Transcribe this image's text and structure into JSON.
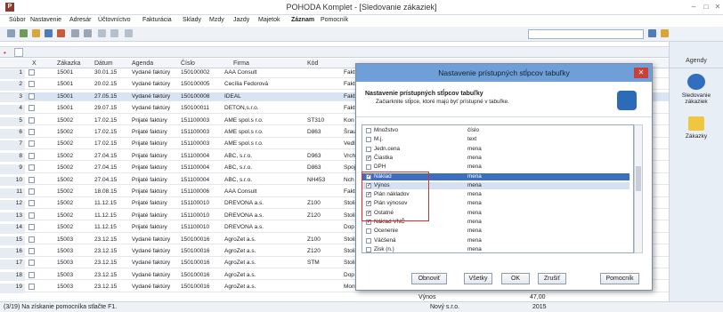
{
  "window": {
    "title": "POHODA Komplet - [Sledovanie zákaziek]",
    "app_icon": "P",
    "minimize": "–",
    "maximize": "□",
    "close": "✕"
  },
  "menu": [
    "Súbor",
    "Nastavenie",
    "Adresár",
    "Účtovníctvo",
    "Fakturácia",
    "Sklady",
    "Mzdy",
    "Jazdy",
    "Majetok",
    "Záznam",
    "Pomocník"
  ],
  "grid": {
    "columns": [
      "X",
      "Zákazka",
      "Dátum",
      "Agenda",
      "Číslo",
      "Firma",
      "Kód"
    ],
    "rows": [
      {
        "n": "1",
        "z": "15001",
        "d": "30.01.15",
        "a": "Vydané faktúry",
        "c": "150100002",
        "f": "AAA Consult",
        "k": "",
        "e": "Fakt"
      },
      {
        "n": "2",
        "z": "15001",
        "d": "20.02.15",
        "a": "Vydané faktúry",
        "c": "150100005",
        "f": "Cecília Fedorová",
        "k": "",
        "e": "Fakt"
      },
      {
        "n": "3",
        "z": "15001",
        "d": "27.05.15",
        "a": "Vydané faktúry",
        "c": "150100008",
        "f": "IDEAL",
        "k": "",
        "e": "Fakt"
      },
      {
        "n": "4",
        "z": "15001",
        "d": "29.07.15",
        "a": "Vydané faktúry",
        "c": "150100011",
        "f": "DETON,s.r.o.",
        "k": "",
        "e": "Fakt"
      },
      {
        "n": "5",
        "z": "15002",
        "d": "17.02.15",
        "a": "Prijaté faktúry",
        "c": "151100003",
        "f": "AME spol.s r.o.",
        "k": "ST310",
        "e": "Kon"
      },
      {
        "n": "6",
        "z": "15002",
        "d": "17.02.15",
        "a": "Prijaté faktúry",
        "c": "151100003",
        "f": "AME spol.s r.o.",
        "k": "D863",
        "e": "Šrau"
      },
      {
        "n": "7",
        "z": "15002",
        "d": "17.02.15",
        "a": "Prijaté faktúry",
        "c": "151100003",
        "f": "AME spol.s r.o.",
        "k": "",
        "e": "Vedl"
      },
      {
        "n": "8",
        "z": "15002",
        "d": "27.04.15",
        "a": "Prijaté faktúry",
        "c": "151100004",
        "f": "ABC, s.r.o.",
        "k": "D963",
        "e": "Vrch"
      },
      {
        "n": "9",
        "z": "15002",
        "d": "27.04.15",
        "a": "Prijaté faktúry",
        "c": "151100004",
        "f": "ABC, s.r.o.",
        "k": "D863",
        "e": "Spoj"
      },
      {
        "n": "10",
        "z": "15002",
        "d": "27.04.15",
        "a": "Prijaté faktúry",
        "c": "151100004",
        "f": "ABC, s.r.o.",
        "k": "NH453",
        "e": "Nch"
      },
      {
        "n": "11",
        "z": "15002",
        "d": "18.08.15",
        "a": "Prijaté faktúry",
        "c": "151100006",
        "f": "AAA Consult",
        "k": "",
        "e": "Fakt"
      },
      {
        "n": "12",
        "z": "15002",
        "d": "11.12.15",
        "a": "Prijaté faktúry",
        "c": "151100010",
        "f": "DREVONA a.s.",
        "k": "Z100",
        "e": "Stoli"
      },
      {
        "n": "13",
        "z": "15002",
        "d": "11.12.15",
        "a": "Prijaté faktúry",
        "c": "151100010",
        "f": "DREVONA a.s.",
        "k": "Z120",
        "e": "Stoli"
      },
      {
        "n": "14",
        "z": "15002",
        "d": "11.12.15",
        "a": "Prijaté faktúry",
        "c": "151100010",
        "f": "DREVONA a.s.",
        "k": "",
        "e": "Dop"
      },
      {
        "n": "15",
        "z": "15003",
        "d": "23.12.15",
        "a": "Vydané faktúry",
        "c": "150100016",
        "f": "AgroZet a.s.",
        "k": "Z100",
        "e": "Stoli"
      },
      {
        "n": "16",
        "z": "15003",
        "d": "23.12.15",
        "a": "Vydané faktúry",
        "c": "150100016",
        "f": "AgroZet a.s.",
        "k": "Z120",
        "e": "Stoli"
      },
      {
        "n": "17",
        "z": "15003",
        "d": "23.12.15",
        "a": "Vydané faktúry",
        "c": "150100016",
        "f": "AgroZet a.s.",
        "k": "STM",
        "e": "Stoli"
      },
      {
        "n": "18",
        "z": "15003",
        "d": "23.12.15",
        "a": "Vydané faktúry",
        "c": "150100016",
        "f": "AgroZet a.s.",
        "k": "",
        "e": "Dop"
      },
      {
        "n": "19",
        "z": "15003",
        "d": "23.12.15",
        "a": "Vydané faktúry",
        "c": "150100016",
        "f": "AgroZet a.s.",
        "k": "",
        "e": "Montáž"
      }
    ]
  },
  "dialog": {
    "title": "Nastavenie prístupných stĺpcov tabuľky",
    "heading": "Nastavenie prístupných stĺpcov tabuľky",
    "subheading": "Začiarknite stĺpce, ktoré majú byť prístupné v tabuľke.",
    "items": [
      {
        "name": "Množstvo",
        "type": "číslo",
        "checked": false
      },
      {
        "name": "M.j.",
        "type": "text",
        "checked": false
      },
      {
        "name": "Jedn.cena",
        "type": "mena",
        "checked": false
      },
      {
        "name": "Čiastka",
        "type": "mena",
        "checked": true
      },
      {
        "name": "DPH",
        "type": "mena",
        "checked": false
      },
      {
        "name": "Náklad",
        "type": "mena",
        "checked": true
      },
      {
        "name": "Výnos",
        "type": "mena",
        "checked": true
      },
      {
        "name": "Plán nákladov",
        "type": "mena",
        "checked": true
      },
      {
        "name": "Plán výnosov",
        "type": "mena",
        "checked": true
      },
      {
        "name": "Ostatné",
        "type": "mena",
        "checked": true
      },
      {
        "name": "Náklad VNČ",
        "type": "mena",
        "checked": true
      },
      {
        "name": "Ocenenie",
        "type": "mena",
        "checked": false
      },
      {
        "name": "Väčšená",
        "type": "mena",
        "checked": false
      },
      {
        "name": "Zisk (n.)",
        "type": "mena",
        "checked": false
      }
    ],
    "buttons": {
      "obnovit": "Obnoviť",
      "vsetky": "Všetky",
      "ok": "OK",
      "zrusit": "Zrušiť",
      "pomocnik": "Pomocník"
    }
  },
  "agendy": {
    "header": "Agendy",
    "item1": "Sledovanie zákaziek",
    "item2": "Zákazky"
  },
  "status": {
    "hint": "(3/19) Na získanie pomocníka stlačte F1.",
    "firm": "Nový s.r.o.",
    "year": "2015",
    "vynos": "Výnos",
    "value": "47,00"
  }
}
